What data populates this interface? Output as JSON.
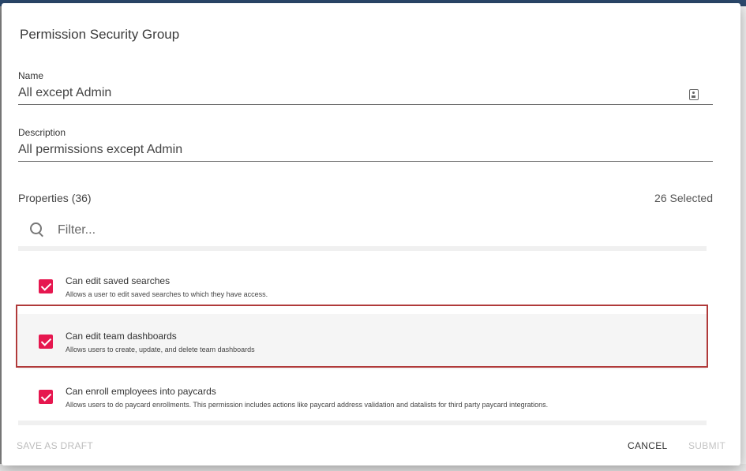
{
  "dialog": {
    "title": "Permission Security Group"
  },
  "name_field": {
    "label": "Name",
    "value": "All except Admin"
  },
  "description_field": {
    "label": "Description",
    "value": "All permissions except Admin"
  },
  "properties": {
    "title": "Properties (36)",
    "selected_count": "26 Selected",
    "filter_placeholder": "Filter...",
    "items": [
      {
        "title": "Can edit saved searches",
        "description": "Allows a user to edit saved searches to which they have access.",
        "checked": true
      },
      {
        "title": "Can edit team dashboards",
        "description": "Allows users to create, update, and delete team dashboards",
        "checked": true
      },
      {
        "title": "Can enroll employees into paycards",
        "description": "Allows users to do paycard enrollments. This permission includes actions like paycard address validation and datalists for third party paycard integrations.",
        "checked": true
      }
    ]
  },
  "footer": {
    "save_draft_label": "SAVE AS DRAFT",
    "cancel_label": "CANCEL",
    "submit_label": "SUBMIT"
  },
  "colors": {
    "checkbox": "#e6174f",
    "highlight_frame": "#b03a3a"
  }
}
